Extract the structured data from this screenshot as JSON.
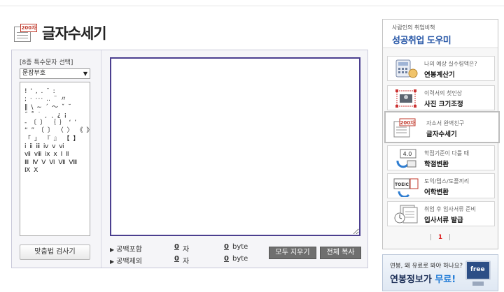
{
  "page": {
    "title": "글자수세기",
    "title_icon_tag": "200자"
  },
  "special_chars": {
    "label": "[8종 특수문자 선택]",
    "selected": "문장부호",
    "lines": [
      "! ' , . ¯ :",
      "; · ··· ‥ ¨ 〃",
      "‖ \\ ∼ ´ ～ ˇ ˘",
      "˝ ˚ ˙ ¸ ˛ ¿ ¡",
      "‐ 〔 〕 ｛ ｝ ‘ ’",
      "“ ” 〔 〕 〈 〉 《 》",
      "「 」 『 』 【 】",
      "ⅰ ⅱ ⅲ ⅳ ⅴ ⅵ",
      "ⅶ ⅷ ⅸ ⅹ Ⅰ Ⅱ",
      "Ⅲ Ⅳ Ⅴ Ⅵ Ⅶ Ⅷ",
      "Ⅸ Ⅹ"
    ],
    "spell_check_button": "맞춤법 검사기"
  },
  "editor": {
    "text": ""
  },
  "stats": {
    "with_space_label": "공백포함",
    "without_space_label": "공백제외",
    "with_space_chars": "0",
    "with_space_bytes": "0",
    "without_space_chars": "0",
    "without_space_bytes": "0",
    "char_unit": "자",
    "byte_unit": "byte"
  },
  "actions": {
    "clear_all": "모두 지우기",
    "copy_all": "전체 복사"
  },
  "sidebar": {
    "subtitle": "사람인의 취업비책",
    "title": "성공취업 도우미",
    "items": [
      {
        "line1": "나의 예상 실수령액은?",
        "line2": "연봉계산기",
        "icon": "calculator-icon"
      },
      {
        "line1": "이력서의 첫인상",
        "line2": "사진 크기조정",
        "icon": "photo-resize-icon"
      },
      {
        "line1": "자소서 완벽친구",
        "line2": "글자수세기",
        "icon": "character-count-icon",
        "icon_tag": "200자"
      },
      {
        "line1": "학점기준이 다를 때",
        "line2": "학점변환",
        "icon": "grade-convert-icon",
        "icon_tag": "4.0"
      },
      {
        "line1": "토익/텝스/토플끼리",
        "line2": "어학변환",
        "icon": "language-convert-icon",
        "icon_tag": "TOEIC"
      },
      {
        "line1": "취업 후 입사서류 준비",
        "line2": "입사서류 발급",
        "icon": "document-issue-icon"
      }
    ],
    "pager_current": "1"
  },
  "banner": {
    "line1": "연봉, 왜 유료로 봐야 하나요?",
    "line2_prefix": "연봉정보가 ",
    "line2_highlight": "무료!",
    "badge": "free"
  }
}
